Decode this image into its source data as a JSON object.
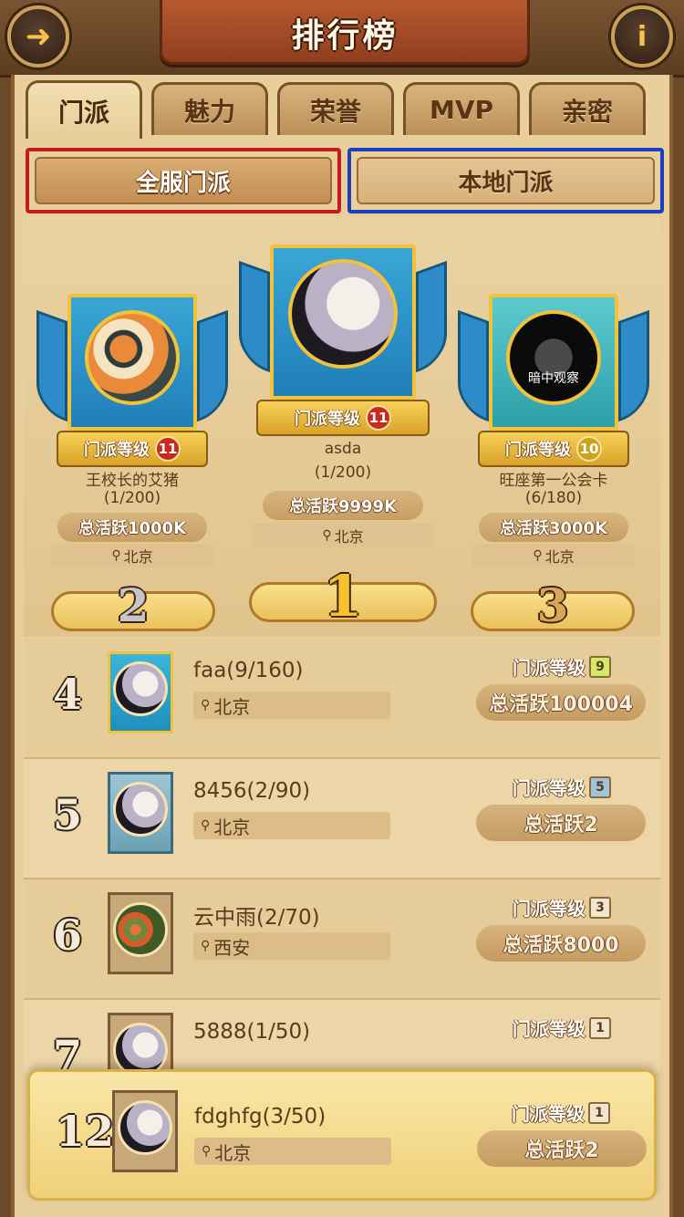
{
  "header": {
    "title": "排行榜",
    "back_icon": "back-arrow-icon",
    "info_label": "i"
  },
  "tabs": [
    {
      "label": "门派",
      "active": true
    },
    {
      "label": "魅力",
      "active": false
    },
    {
      "label": "荣誉",
      "active": false
    },
    {
      "label": "MVP",
      "active": false
    },
    {
      "label": "亲密",
      "active": false
    }
  ],
  "subtabs": {
    "all": "全服门派",
    "local": "本地门派"
  },
  "level_label": "门派等级",
  "podium": [
    {
      "rank": "2",
      "name": "王校长的艾猪",
      "count": "(1/200)",
      "level": "11",
      "activity": "总活跃1000K",
      "location": "北京",
      "avatar_text": ""
    },
    {
      "rank": "1",
      "name": "asda",
      "count": "(1/200)",
      "level": "11",
      "activity": "总活跃9999K",
      "location": "北京",
      "avatar_text": ""
    },
    {
      "rank": "3",
      "name": "旺座第一公会卡",
      "count": "(6/180)",
      "level": "10",
      "activity": "总活跃3000K",
      "location": "北京",
      "avatar_text": "暗中观察"
    }
  ],
  "list": [
    {
      "rank": "4",
      "name": "faa(9/160)",
      "location": "北京",
      "level": "9",
      "activity": "总活跃100004"
    },
    {
      "rank": "5",
      "name": "8456(2/90)",
      "location": "北京",
      "level": "5",
      "activity": "总活跃2"
    },
    {
      "rank": "6",
      "name": "云中雨(2/70)",
      "location": "西安",
      "level": "3",
      "activity": "总活跃8000"
    },
    {
      "rank": "7",
      "name": "5888(1/50)",
      "location": "",
      "level": "1",
      "activity": ""
    }
  ],
  "mine": {
    "rank": "12",
    "name": "fdghfg(3/50)",
    "location": "北京",
    "level": "1",
    "activity": "总活跃2"
  },
  "colors": {
    "highlight_red": "#c31d1d",
    "highlight_blue": "#1c3fbf",
    "banner_blue": "#2d8bc7",
    "gold": "#f2c23a"
  }
}
